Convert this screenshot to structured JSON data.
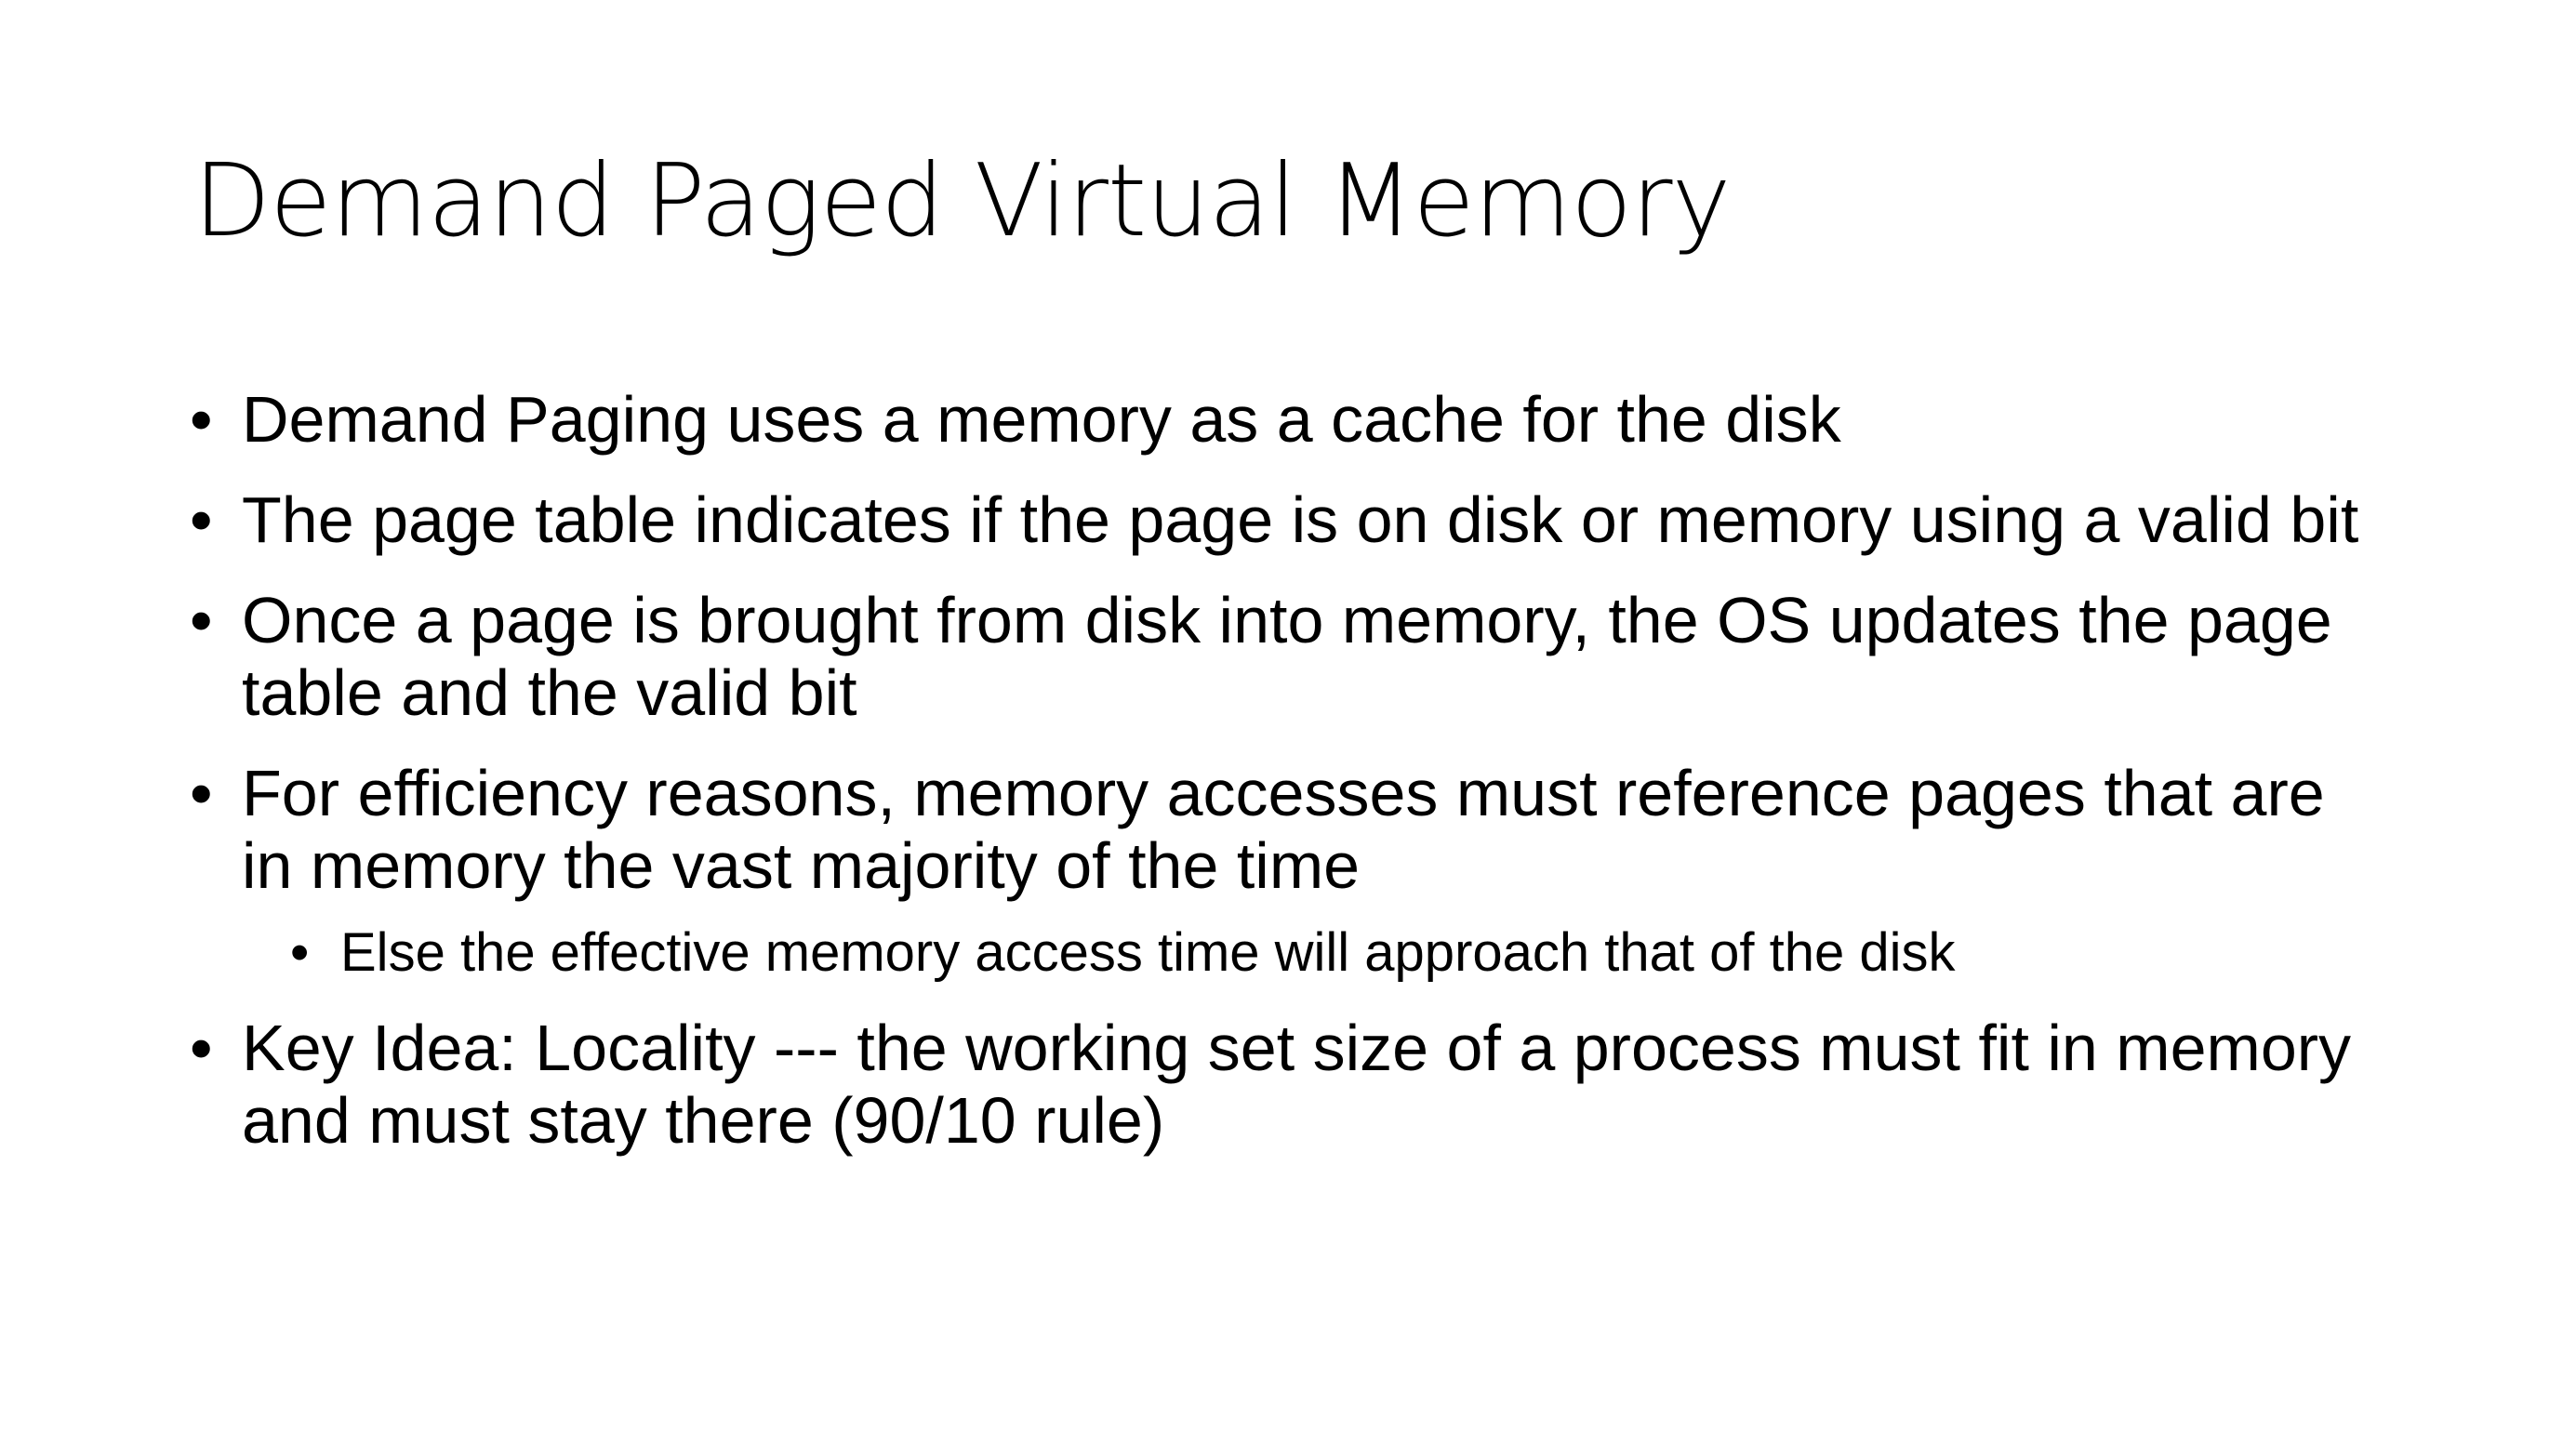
{
  "slide": {
    "title": "Demand Paged Virtual Memory",
    "bullet_glyph": "•",
    "bullets": [
      {
        "text": "Demand Paging uses a memory as a cache for the disk"
      },
      {
        "text": "The page table indicates if the page is on disk or memory using a valid bit"
      },
      {
        "text": "Once a page is brought from disk into memory, the OS updates the page table and the valid bit"
      },
      {
        "text": "For efficiency reasons, memory accesses must reference pages that are in memory the vast majority of the time",
        "sub": [
          {
            "text": "Else the effective memory access time will approach that of the disk"
          }
        ]
      },
      {
        "text": "Key Idea: Locality --- the working set size of a process must fit in memory and must stay there (90/10 rule)"
      }
    ]
  }
}
